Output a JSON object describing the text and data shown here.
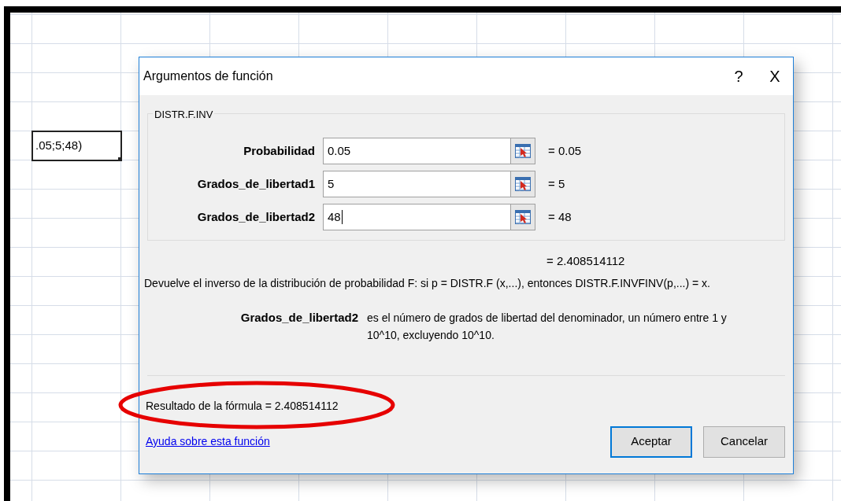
{
  "sheet": {
    "active_cell": {
      "text": ".05;5;48)"
    }
  },
  "dialog": {
    "title": "Argumentos de función",
    "help_button": "?",
    "close_button": "X",
    "function_name": "DISTR.F.INV",
    "arguments": [
      {
        "label": "Probabilidad",
        "value": "0.05",
        "result": "= 0.05",
        "focused": false
      },
      {
        "label": "Grados_de_libertad1",
        "value": "5",
        "result": "= 5",
        "focused": false
      },
      {
        "label": "Grados_de_libertad2",
        "value": "48",
        "result": "= 48",
        "focused": true
      }
    ],
    "function_result": "= 2.408514112",
    "description": "Devuelve el inverso de la distribución de probabilidad F: si p = DISTR.F (x,...), entonces DISTR.F.INVFINV(p,...) = x.",
    "argument_help": {
      "name": "Grados_de_libertad2",
      "text": "es el número de grados de libertad del denominador, un número entre 1 y 10^10, excluyendo 10^10."
    },
    "formula_result_label": "Resultado de la fórmula =",
    "formula_result": "2.408514112",
    "help_link": "Ayuda sobre esta función",
    "buttons": [
      {
        "label": "Aceptar",
        "default": true
      },
      {
        "label": "Cancelar",
        "default": false
      }
    ]
  }
}
